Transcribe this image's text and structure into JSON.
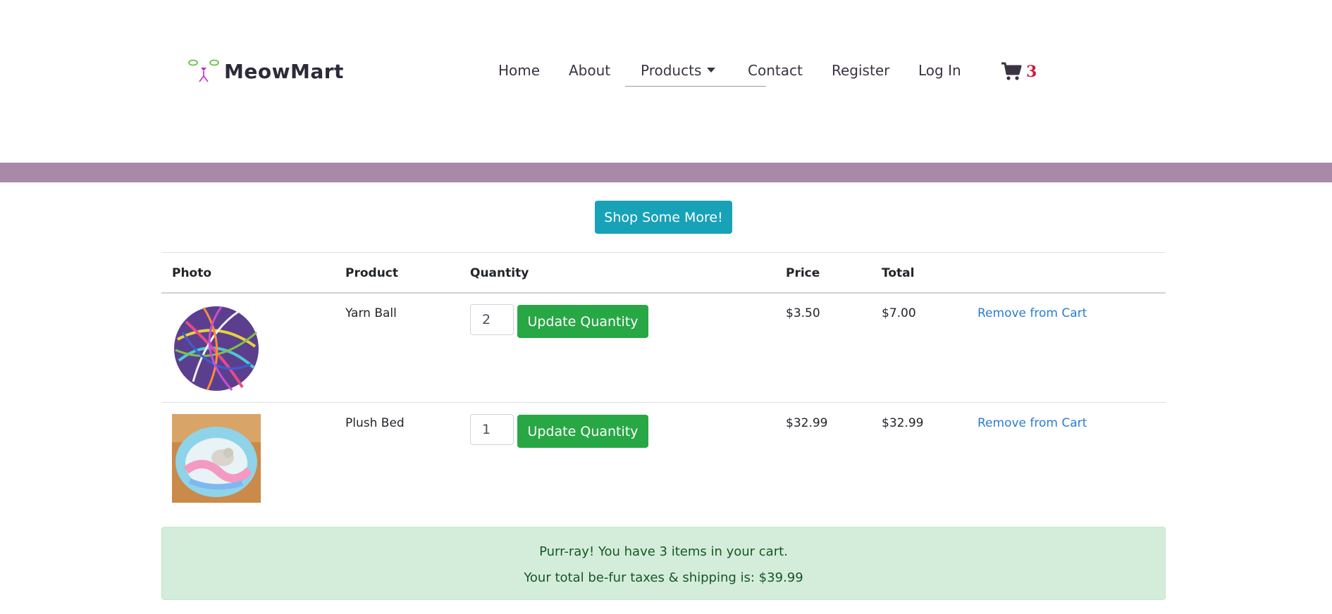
{
  "brand": {
    "name": "MeowMart"
  },
  "nav": {
    "home": "Home",
    "about": "About",
    "products": "Products",
    "contact": "Contact",
    "register": "Register",
    "login": "Log In"
  },
  "cart_badge": {
    "count": "3",
    "icon": "shopping-cart-icon"
  },
  "colors": {
    "band": "#a889a8",
    "shop_button": "#17a2b8",
    "update_button": "#28a745",
    "link": "#2a7bd4",
    "cart_count": "#d11a3b",
    "summary_bg": "#d4edda",
    "summary_text": "#155724"
  },
  "shop_more": "Shop Some More!",
  "table": {
    "headers": {
      "photo": "Photo",
      "product": "Product",
      "quantity": "Quantity",
      "price": "Price",
      "total": "Total"
    },
    "rows": [
      {
        "product": "Yarn Ball",
        "quantity": "2",
        "update_label": "Update Quantity",
        "price": "$3.50",
        "total": "$7.00",
        "remove_label": "Remove from Cart",
        "photo": "yarn-ball-photo"
      },
      {
        "product": "Plush Bed",
        "quantity": "1",
        "update_label": "Update Quantity",
        "price": "$32.99",
        "total": "$32.99",
        "remove_label": "Remove from Cart",
        "photo": "plush-bed-photo"
      }
    ]
  },
  "summary": {
    "items_line": "Purr-ray! You have 3 items in your cart.",
    "total_line": "Your total be-fur taxes & shipping is: $39.99"
  }
}
